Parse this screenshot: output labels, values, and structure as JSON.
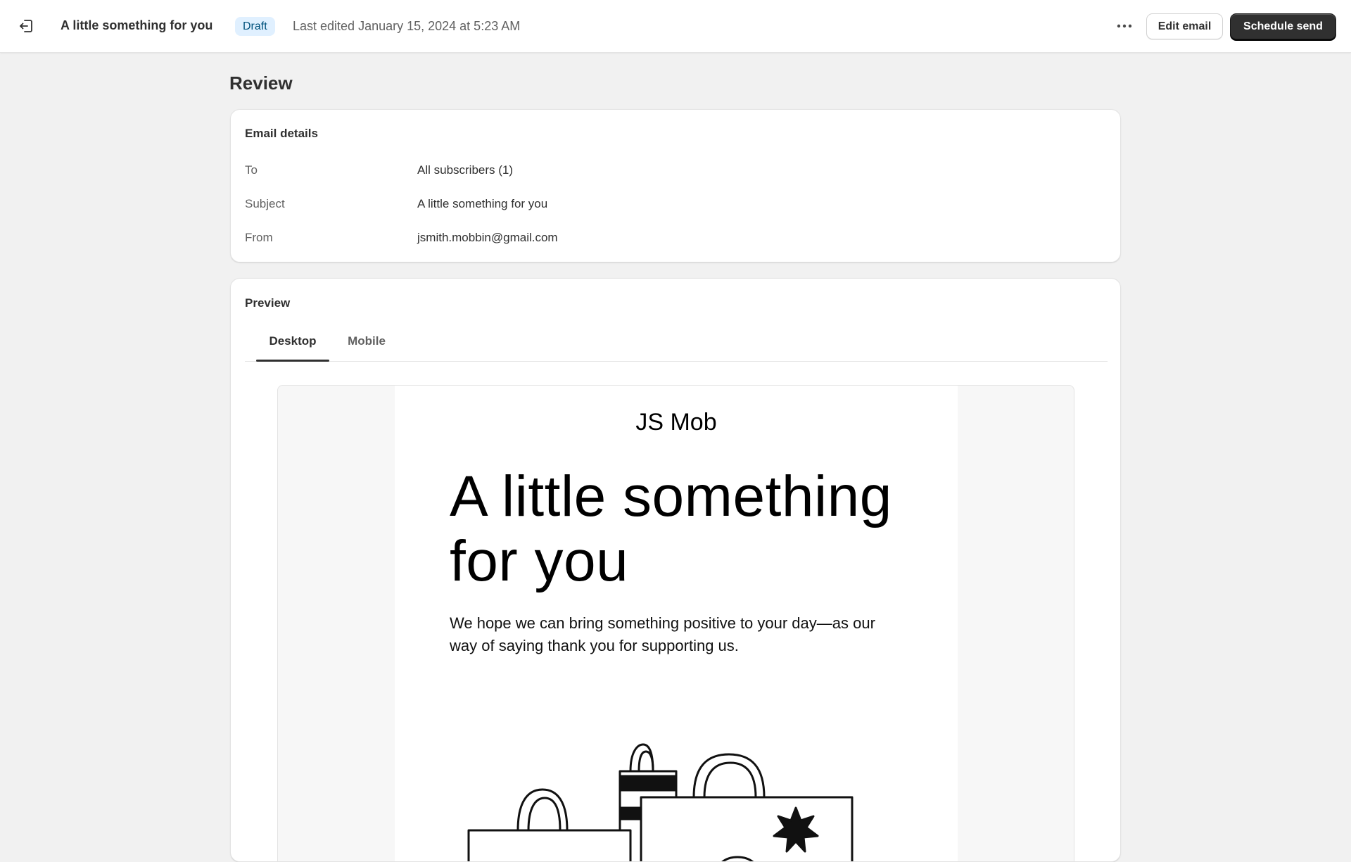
{
  "topbar": {
    "exit_icon": "exit-icon",
    "title": "A little something for you",
    "status_badge": "Draft",
    "last_edited": "Last edited January 15, 2024 at 5:23 AM",
    "more_icon": "more-horizontal-icon",
    "edit_label": "Edit email",
    "schedule_label": "Schedule send"
  },
  "page": {
    "heading": "Review"
  },
  "details": {
    "title": "Email details",
    "rows": [
      {
        "label": "To",
        "value": "All subscribers (1)"
      },
      {
        "label": "Subject",
        "value": "A little something for you"
      },
      {
        "label": "From",
        "value": "jsmith.mobbin@gmail.com"
      }
    ]
  },
  "preview": {
    "title": "Preview",
    "tabs": [
      {
        "label": "Desktop",
        "active": true
      },
      {
        "label": "Mobile",
        "active": false
      }
    ],
    "email": {
      "shop_name": "JS Mob",
      "headline": "A little something for you",
      "paragraph": "We hope we can bring something positive to your day—as our way of saying thank you for supporting us.",
      "illustration_icon": "shopping-bags-illustration"
    }
  },
  "colors": {
    "page_background": "#f1f1f1",
    "primary_button": "#303030",
    "badge_background": "#e0f0ff",
    "badge_text": "#00527c"
  }
}
